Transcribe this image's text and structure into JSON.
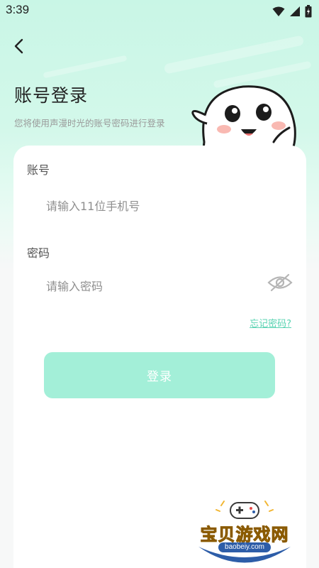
{
  "status_bar": {
    "time": "3:39"
  },
  "header": {
    "back_icon": "chevron-left-icon",
    "title": "账号登录",
    "subtitle": "您将使用声漫时光的账号密码进行登录"
  },
  "form": {
    "account_label": "账号",
    "account_placeholder": "请输入11位手机号",
    "password_label": "密码",
    "password_placeholder": "请输入密码",
    "password_visibility_icon": "eye-off-icon",
    "forgot_password": "忘记密码?",
    "login_button": "登录"
  },
  "watermark": {
    "text": "宝贝游戏网",
    "url": "baobeiy.com"
  },
  "colors": {
    "accent": "#59d3b2",
    "button_bg": "#a3efd8",
    "background_top": "#c9f6e6"
  }
}
